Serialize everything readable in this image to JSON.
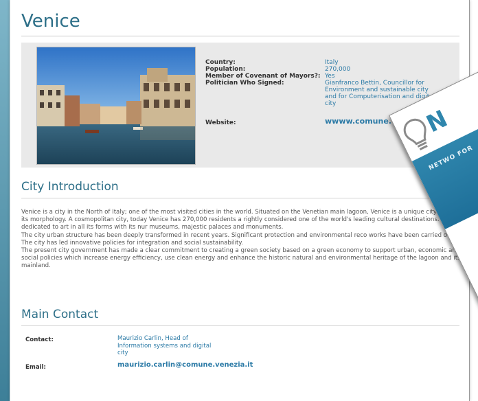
{
  "page": {
    "title": "Venice"
  },
  "info": {
    "rows": [
      {
        "key": "Country:",
        "value": "Italy"
      },
      {
        "key": "Population:",
        "value": "270,000"
      },
      {
        "key": "Member of Covenant of Mayors?:",
        "value": "Yes"
      },
      {
        "key": "Politician Who Signed:",
        "value": "Gianfranco Bettin, Councillor for Environment and sustainable city and for Computerisation and digital city"
      },
      {
        "key": "Website:",
        "value": "wwww.comune.venezia.it"
      }
    ]
  },
  "intro": {
    "heading": "City Introduction",
    "paragraphs": [
      "Venice is a city in the North of Italy; one of the most visited cities in the world. Situated on the Venetian main lagoon, Venice is a unique city due to its morphology. A cosmopolitan city, today Venice has 270,000 residents a rightly considered one of the world's leading cultural destinations. It is dedicated to art in all its forms with its nur museums, majestic palaces and monuments.",
      "The city urban structure has been deeply transformed in recent years. Significant protection and environmental reco works have been carried out. The city has led innovative policies for integration and social sustainability.",
      "The present city government has made a clear commitment to creating a green society based on a green economy to support urban, economic and social policies which increase energy efficiency, use clean energy and enhance the historic natural and environmental heritage of the lagoon and its mainland."
    ]
  },
  "contact": {
    "heading": "Main Contact",
    "contact_label": "Contact:",
    "contact_value": "Maurizio Carlin, Head of Information systems and digital city",
    "email_label": "Email:",
    "email_value": "maurizio.carlin@comune.venezia.it"
  },
  "brochure": {
    "logo_text": "N",
    "subtitle": "NETWO FOR"
  }
}
